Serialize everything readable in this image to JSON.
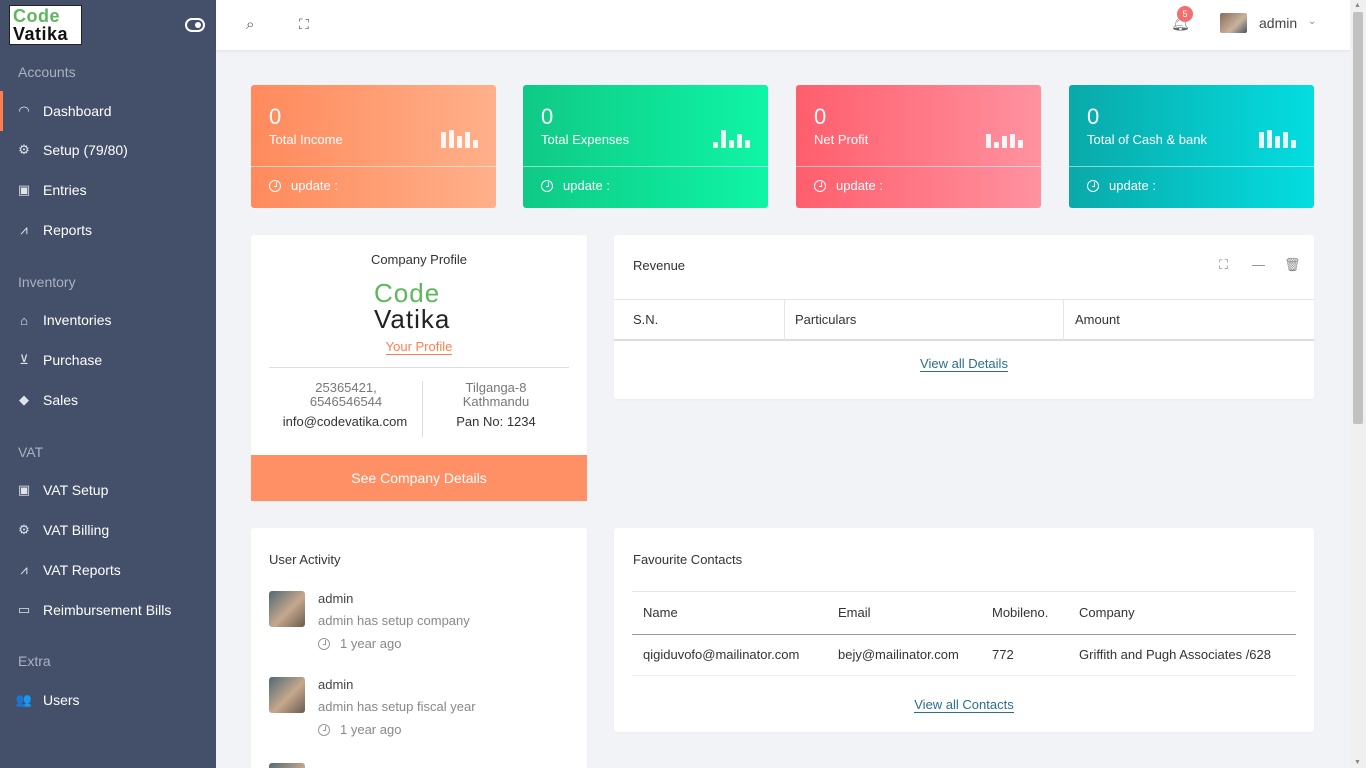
{
  "brand": {
    "line1": "Code",
    "line2": "Vatika"
  },
  "sidebar": {
    "sections": [
      {
        "title": "Accounts"
      },
      {
        "title": "Inventory"
      },
      {
        "title": "VAT"
      },
      {
        "title": "Extra"
      }
    ],
    "items": [
      {
        "label": "Dashboard",
        "icon": "dashboard-icon"
      },
      {
        "label": "Setup (79/80)",
        "icon": "gear-icon"
      },
      {
        "label": "Entries",
        "icon": "clipboard-icon"
      },
      {
        "label": "Reports",
        "icon": "chart-line-icon"
      },
      {
        "label": "Inventories",
        "icon": "home-icon"
      },
      {
        "label": "Purchase",
        "icon": "cart-icon"
      },
      {
        "label": "Sales",
        "icon": "tag-icon"
      },
      {
        "label": "VAT Setup",
        "icon": "clipboard-icon"
      },
      {
        "label": "VAT Billing",
        "icon": "gear-icon"
      },
      {
        "label": "VAT Reports",
        "icon": "chart-line-icon"
      },
      {
        "label": "Reimbursement Bills",
        "icon": "money-icon"
      },
      {
        "label": "Users",
        "icon": "users-icon"
      }
    ]
  },
  "topbar": {
    "notification_count": "5",
    "user_name": "admin"
  },
  "stats": [
    {
      "value": "0",
      "label": "Total Income",
      "update": "update :",
      "color_from": "#ff8a5c",
      "color_to": "#ffb08a"
    },
    {
      "value": "0",
      "label": "Total Expenses",
      "update": "update :",
      "color_from": "#0fc986",
      "color_to": "#0ff5a6"
    },
    {
      "value": "0",
      "label": "Net Profit",
      "update": "update :",
      "color_from": "#ff5e6c",
      "color_to": "#ff92a0"
    },
    {
      "value": "0",
      "label": "Total of Cash & bank",
      "update": "update :",
      "color_from": "#0aa9a9",
      "color_to": "#04dde0"
    }
  ],
  "company": {
    "title": "Company Profile",
    "logo_line1": "Code",
    "logo_line2": "Vatika",
    "profile_link": "Your Profile",
    "phone": "25365421, 6546546544",
    "email": "info@codevatika.com",
    "address": "Tilganga-8 Kathmandu",
    "pan": "Pan No: 1234",
    "button": "See Company Details"
  },
  "revenue": {
    "title": "Revenue",
    "columns": [
      "S.N.",
      "Particulars",
      "Amount"
    ],
    "link": "View all Details"
  },
  "activity": {
    "title": "User Activity",
    "items": [
      {
        "name": "admin",
        "action": "admin has setup company",
        "time": "1 year ago"
      },
      {
        "name": "admin",
        "action": "admin has setup fiscal year",
        "time": "1 year ago"
      }
    ]
  },
  "contacts": {
    "title": "Favourite Contacts",
    "columns": [
      "Name",
      "Email",
      "Mobileno.",
      "Company"
    ],
    "rows": [
      {
        "name": "qigiduvofo@mailinator.com",
        "email": "bejy@mailinator.com",
        "mobile": "772",
        "company": "Griffith and Pugh Associates /628"
      }
    ],
    "link": "View all Contacts"
  }
}
